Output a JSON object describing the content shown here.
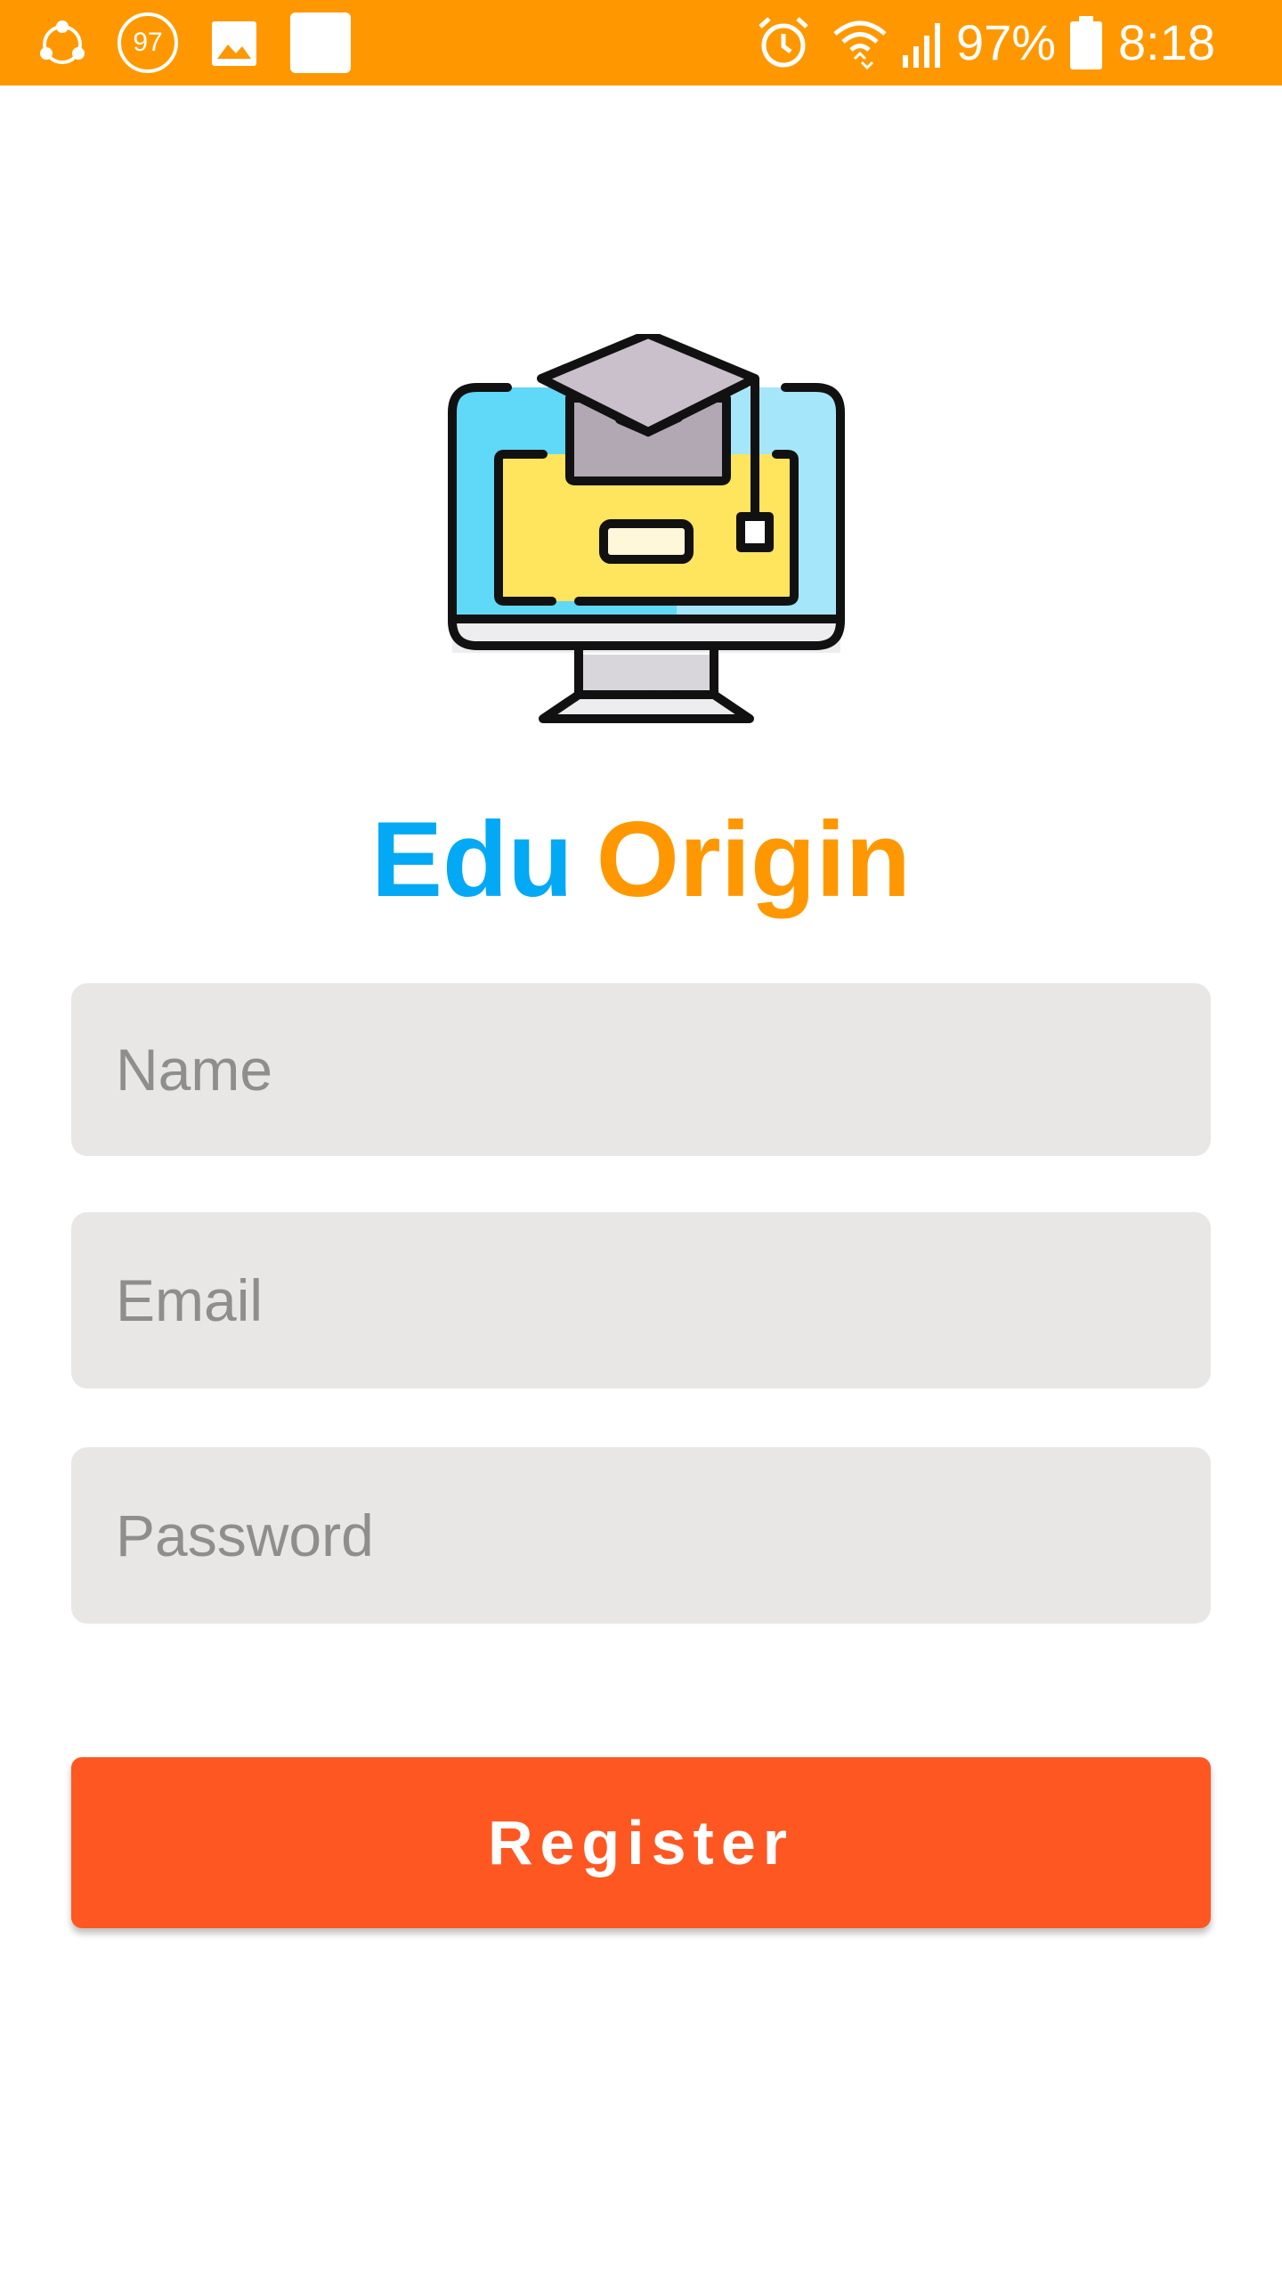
{
  "status_bar": {
    "notification_badge": "97",
    "battery_percent": "97%",
    "time": "8:18",
    "icons": [
      "share-icon",
      "badge-97-icon",
      "image-icon",
      "blank-square-icon",
      "alarm-icon",
      "wifi-icon",
      "signal-icon",
      "battery-icon"
    ],
    "background_color": "#FF9800"
  },
  "logo": {
    "icon": "computer-graduation-cap-icon"
  },
  "brand": {
    "part1": "Edu",
    "part2": "Origin",
    "part1_color": "#03A9F4",
    "part2_color": "#FF9800"
  },
  "form": {
    "name_placeholder": "Name",
    "email_placeholder": "Email",
    "password_placeholder": "Password",
    "field_background": "#E8E7E6"
  },
  "register_button": {
    "label": "Register",
    "color": "#FF5722"
  }
}
